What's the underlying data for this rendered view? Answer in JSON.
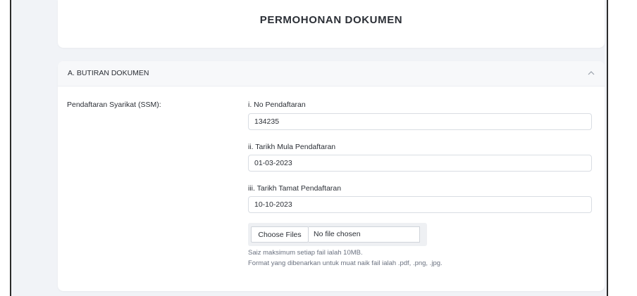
{
  "page": {
    "title": "PERMOHONAN DOKUMEN"
  },
  "section": {
    "header": "A. BUTIRAN DOKUMEN",
    "toggle_icon": "chevron-up-icon",
    "field_group_label": "Pendaftaran Syarikat (SSM):",
    "fields": [
      {
        "label": "i. No Pendaftaran",
        "value": "134235"
      },
      {
        "label": "ii. Tarikh Mula Pendaftaran",
        "value": "01-03-2023"
      },
      {
        "label": "iii. Tarikh Tamat Pendaftaran",
        "value": "10-10-2023"
      }
    ],
    "upload": {
      "button_label": "Choose Files",
      "status": "No file chosen",
      "help_size": "Saiz maksimum setiap fail ialah 10MB.",
      "help_format": "Format yang dibenarkan untuk muat naik fail ialah .pdf, .png, .jpg."
    }
  },
  "colors": {
    "page_background": "#f1f3f7",
    "card": "#ffffff",
    "header_bg": "#f7f8fa",
    "border": "#d9dde3",
    "muted_text": "#6b7280"
  }
}
